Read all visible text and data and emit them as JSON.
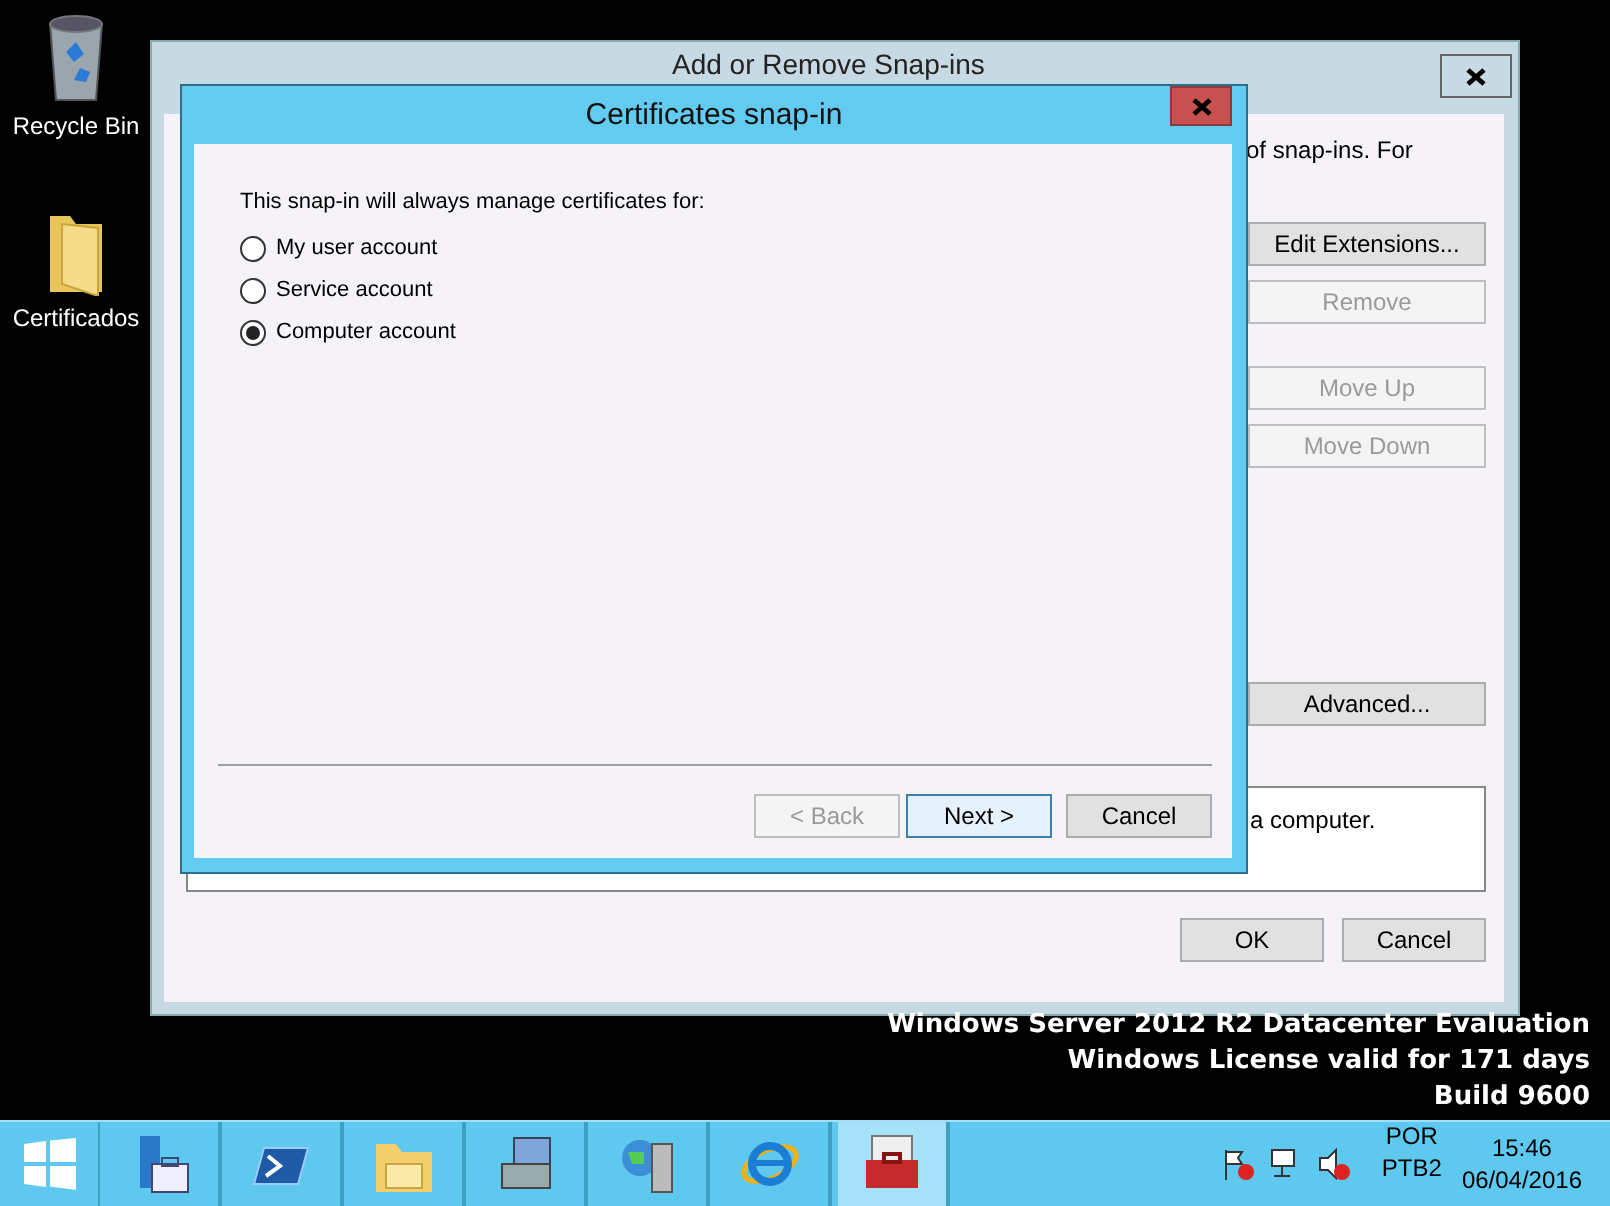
{
  "desktop_icons": [
    {
      "kind": "recycle-bin",
      "label": "Recycle Bin"
    },
    {
      "kind": "folder",
      "label": "Certificados"
    }
  ],
  "back_window": {
    "title": "Add or Remove Snap-ins",
    "intro_text": "of snap-ins. For",
    "side_buttons": [
      {
        "label": "Edit Extensions...",
        "disabled": false
      },
      {
        "label": "Remove",
        "disabled": true
      },
      {
        "label": "Move Up",
        "disabled": true
      },
      {
        "label": "Move Down",
        "disabled": true
      },
      {
        "label": "Advanced...",
        "disabled": false
      }
    ],
    "description": "a computer.",
    "footer_buttons": [
      {
        "label": "OK"
      },
      {
        "label": "Cancel"
      }
    ]
  },
  "dialog": {
    "title": "Certificates snap-in",
    "prompt": "This snap-in will always manage certificates for:",
    "options": [
      {
        "label": "My user account",
        "selected": false
      },
      {
        "label": "Service account",
        "selected": false
      },
      {
        "label": "Computer account",
        "selected": true
      }
    ],
    "buttons": [
      {
        "label": "< Back",
        "disabled": true,
        "default": false
      },
      {
        "label": "Next >",
        "disabled": false,
        "default": true
      },
      {
        "label": "Cancel",
        "disabled": false,
        "default": false
      }
    ]
  },
  "os_notice": [
    "Windows Server 2012 R2 Datacenter Evaluation",
    "Windows License valid for 171 days",
    "Build 9600"
  ],
  "taskbar": {
    "apps": [
      {
        "kind": "server-manager",
        "selected": false
      },
      {
        "kind": "powershell",
        "selected": false
      },
      {
        "kind": "file-explorer",
        "selected": false
      },
      {
        "kind": "computer-tools",
        "selected": false
      },
      {
        "kind": "globe-server",
        "selected": false
      },
      {
        "kind": "browser",
        "selected": false
      },
      {
        "kind": "toolbox",
        "selected": true
      }
    ],
    "language": "POR",
    "keyboard": "PTB2",
    "time": "15:46",
    "date": "06/04/2016"
  }
}
